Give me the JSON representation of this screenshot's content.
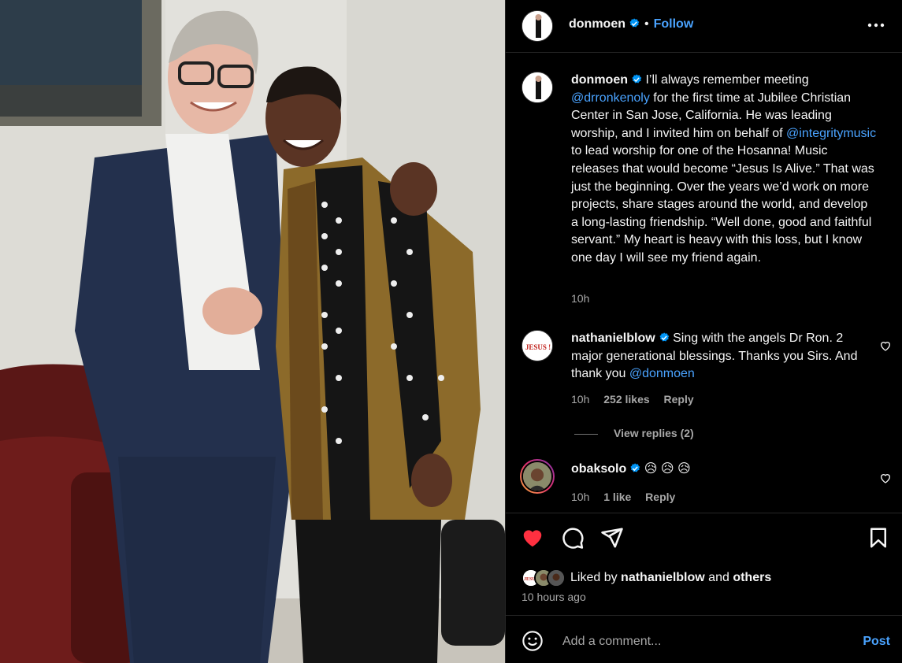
{
  "post": {
    "username": "donmoen",
    "follow_label": "Follow",
    "dot": "•",
    "caption": {
      "username": "donmoen",
      "parts": [
        {
          "t": "I’ll always remember meeting "
        },
        {
          "t": "@drronkenoly",
          "m": true
        },
        {
          "t": " for the first time at Jubilee Christian Center in San Jose, California. He was leading worship, and I invited him on behalf of "
        },
        {
          "t": "@integritymusic",
          "m": true
        },
        {
          "t": " to lead worship for one of the Hosanna! Music releases that would become “Jesus Is Alive.” That was just the beginning. Over the years we’d work on more projects, share stages around the world, and develop a long-lasting friendship. “Well done, good and faithful servant.” My heart is heavy with this loss, but I know one day I will see my friend again."
        }
      ],
      "time": "10h"
    },
    "comments": [
      {
        "username": "nathanielblow",
        "avatar_text": "JESUS !",
        "parts": [
          {
            "t": "Sing with the angels Dr Ron. 2 major generational blessings. Thanks you Sirs. And thank you "
          },
          {
            "t": "@donmoen",
            "m": true
          }
        ],
        "time": "10h",
        "likes": "252 likes",
        "reply": "Reply",
        "view_replies": "View replies (2)"
      },
      {
        "username": "obaksolo",
        "text": "😥 😥 😥",
        "time": "10h",
        "likes": "1 like",
        "reply": "Reply"
      }
    ],
    "liked_by": {
      "prefix": "Liked by ",
      "user": "nathanielblow",
      "middle": " and ",
      "others": "others",
      "avatar_text": "JESUS"
    },
    "time_ago": "10 hours ago",
    "add_comment_placeholder": "Add a comment...",
    "post_label": "Post",
    "colors": {
      "accent": "#4aa3ff",
      "heart": "#ff3040",
      "bg": "#000000",
      "muted": "#a8a8a8"
    },
    "icons": [
      "verified-badge-icon",
      "more-options-icon",
      "heart-icon",
      "comment-icon",
      "share-icon",
      "bookmark-icon",
      "emoji-icon"
    ]
  }
}
